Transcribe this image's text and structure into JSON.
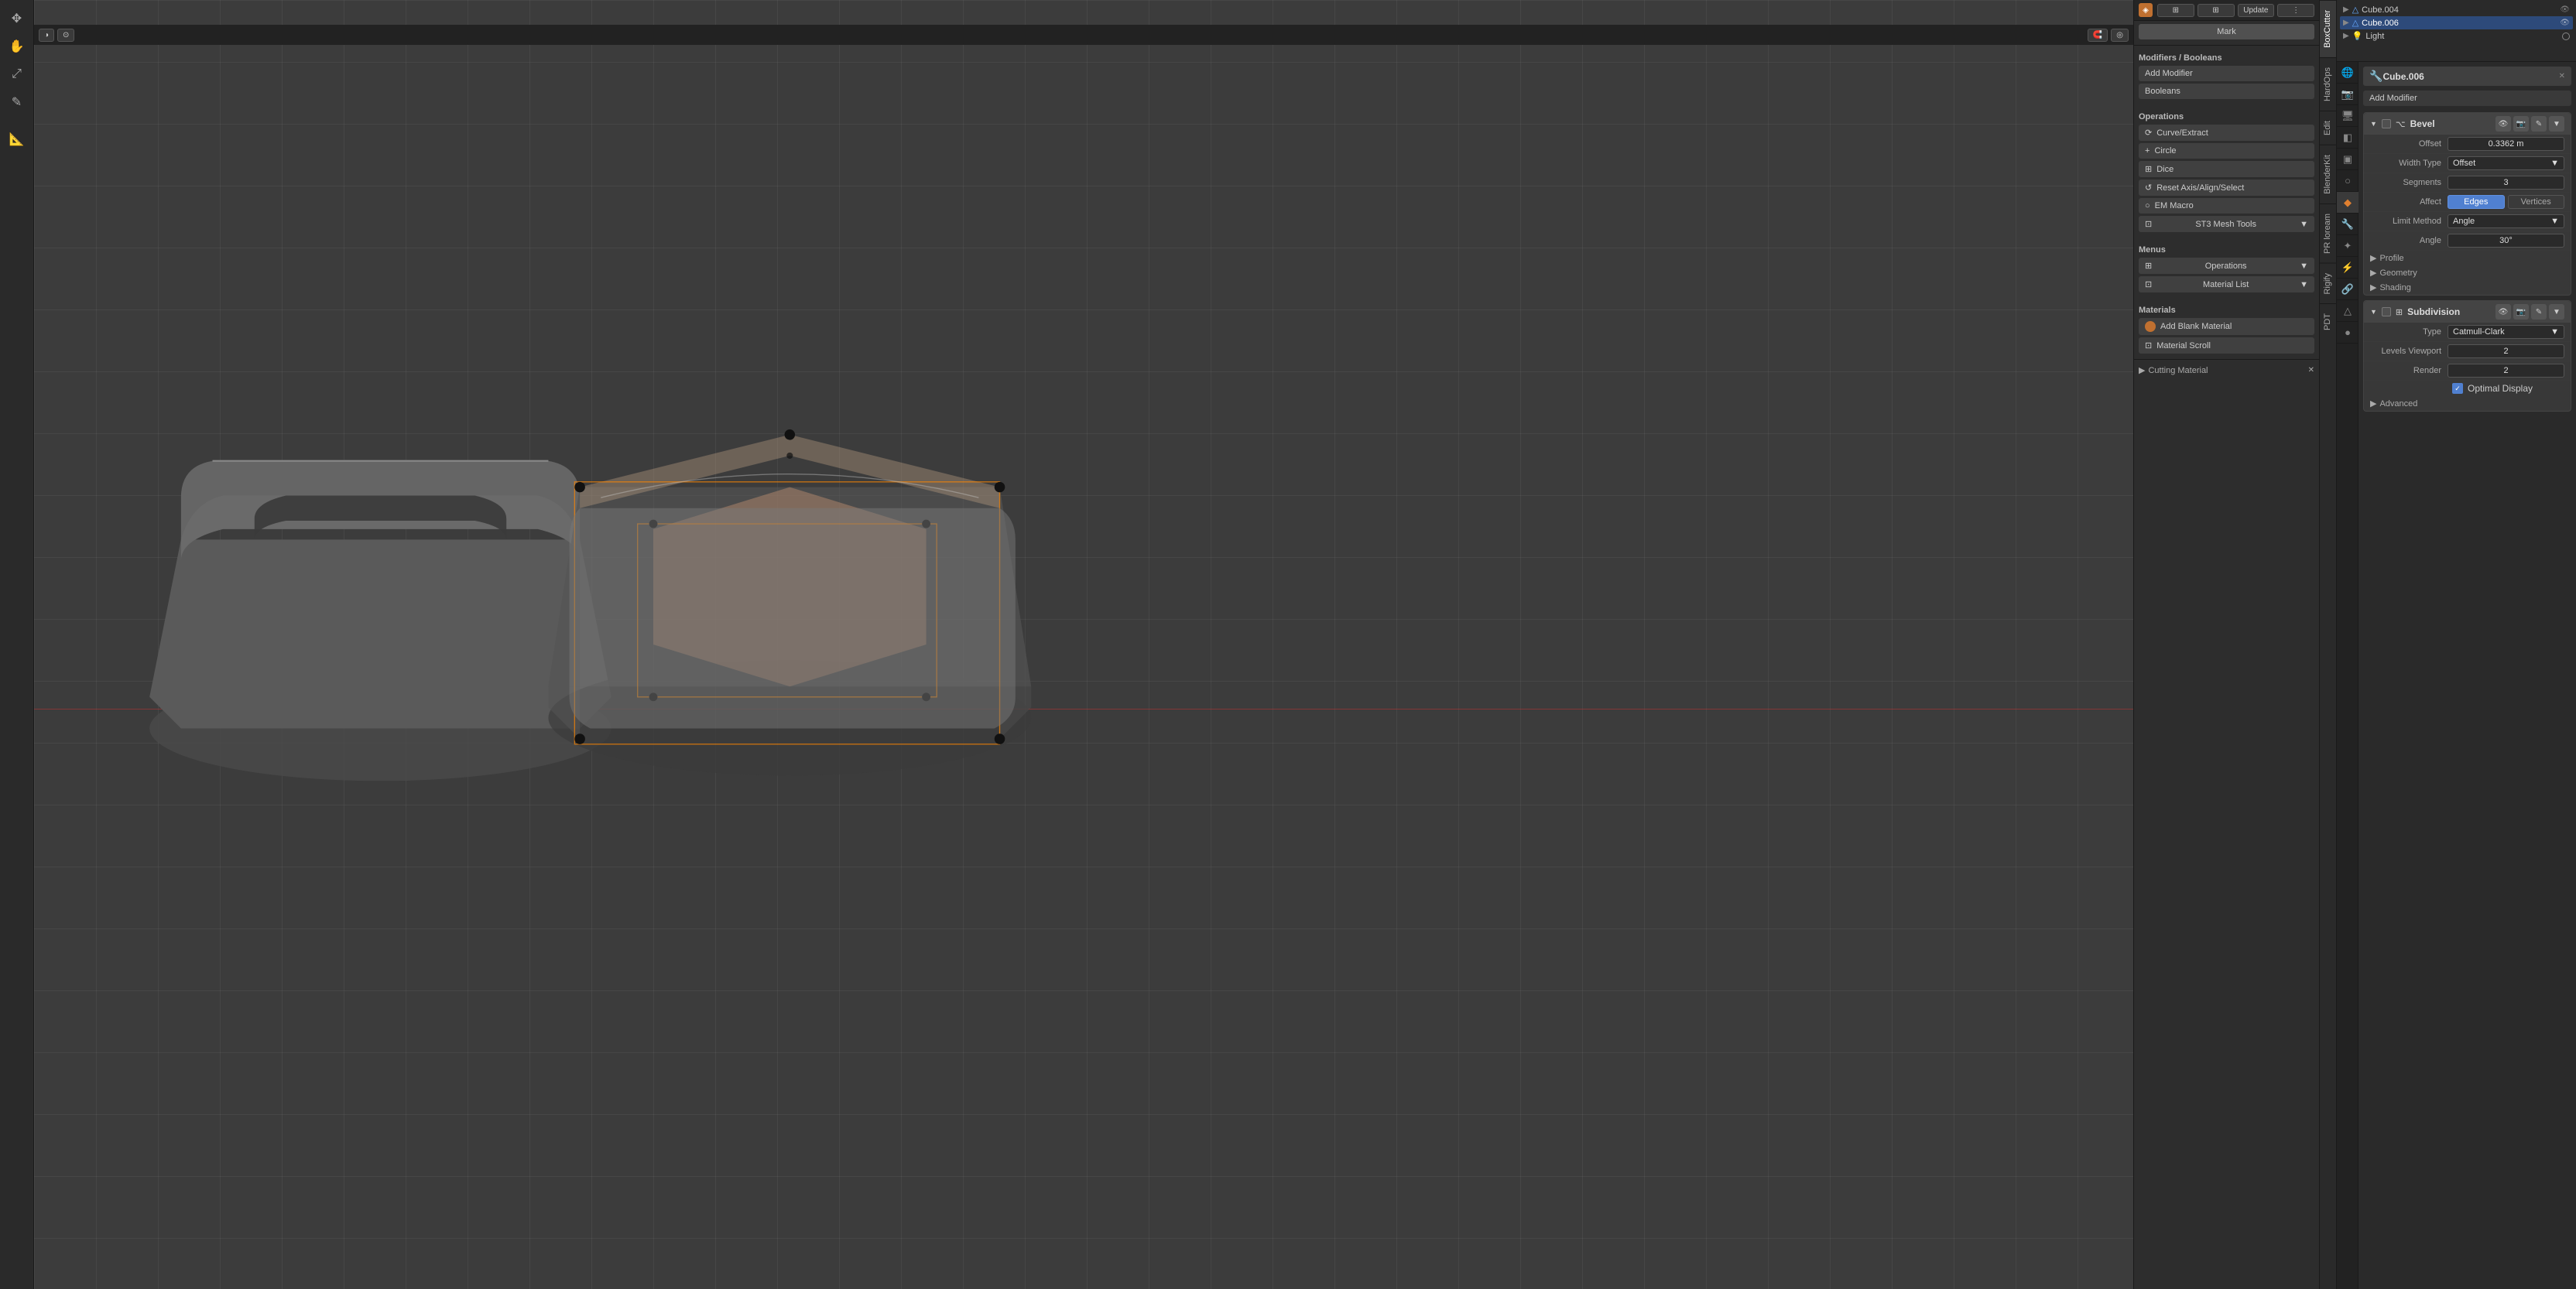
{
  "viewport": {
    "grid_visible": true
  },
  "topbar": {
    "update_btn": "Update",
    "mark_btn": "Mark"
  },
  "n_panel_tabs": [
    {
      "id": "boxcutter",
      "label": "BoxCutter",
      "active": true
    },
    {
      "id": "hardops",
      "label": "HardOps",
      "active": false
    },
    {
      "id": "edit",
      "label": "Edit",
      "active": false
    },
    {
      "id": "blenderkit",
      "label": "BlenderKit",
      "active": false
    },
    {
      "id": "prloream",
      "label": "PR loream",
      "active": false
    },
    {
      "id": "rigify",
      "label": "Rigify",
      "active": false
    },
    {
      "id": "pdt",
      "label": "PDT",
      "active": false
    }
  ],
  "n_panel": {
    "modifiers_booleans_header": "Modifiers / Booleans",
    "add_modifier_btn": "Add Modifier",
    "booleans_btn": "Booleans",
    "operations_header": "Operations",
    "operations": [
      {
        "label": "Curve/Extract",
        "icon": "curve"
      },
      {
        "label": "Circle",
        "icon": "circle"
      },
      {
        "label": "Dice",
        "icon": "dice"
      },
      {
        "label": "Reset Axis/Align/Select",
        "icon": "reset"
      },
      {
        "label": "EM Macro",
        "icon": "macro"
      },
      {
        "label": "ST3 Mesh Tools",
        "icon": "mesh",
        "dropdown": true
      }
    ],
    "menus_header": "Menus",
    "menus": [
      {
        "label": "Operations",
        "dropdown": true
      },
      {
        "label": "Material List",
        "dropdown": true
      }
    ],
    "materials_header": "Materials",
    "add_blank_material_btn": "Add Blank Material",
    "material_scroll_btn": "Material Scroll",
    "cutting_material_header": "Cutting Material"
  },
  "outliner": {
    "items": [
      {
        "label": "Cube.004",
        "icon": "cube",
        "level": 0,
        "selected": false
      },
      {
        "label": "Cube.006",
        "icon": "cube",
        "level": 0,
        "selected": true
      },
      {
        "label": "Light",
        "icon": "light",
        "level": 0,
        "selected": false,
        "light_icon": true
      }
    ]
  },
  "properties": {
    "object_name": "Cube.006",
    "add_modifier_btn": "Add Modifier",
    "modifiers": [
      {
        "type": "Bevel",
        "icon": "bevel",
        "enabled": true,
        "properties": [
          {
            "label": "Offset",
            "value": "0.3362 m"
          },
          {
            "label": "Width Type",
            "value": "Offset"
          },
          {
            "label": "Segments",
            "value": "3"
          },
          {
            "label": "Affect",
            "type": "affect",
            "options": [
              {
                "label": "Edges",
                "active": true
              },
              {
                "label": "Vertices",
                "active": false
              }
            ]
          },
          {
            "label": "Limit Method",
            "value": "Angle"
          },
          {
            "label": "Angle",
            "value": "30°"
          }
        ],
        "collapsible": [
          {
            "label": "Profile"
          },
          {
            "label": "Geometry"
          },
          {
            "label": "Shading"
          }
        ]
      },
      {
        "type": "Subdivision",
        "icon": "subdivision",
        "enabled": true,
        "properties": [
          {
            "label": "Type",
            "value": "Catmull-Clark"
          },
          {
            "label": "Levels Viewport",
            "value": "2"
          },
          {
            "label": "Render",
            "value": "2"
          },
          {
            "label": "Optimal Display",
            "type": "checkbox",
            "checked": true
          }
        ],
        "collapsible": [
          {
            "label": "Advanced"
          }
        ]
      }
    ]
  }
}
